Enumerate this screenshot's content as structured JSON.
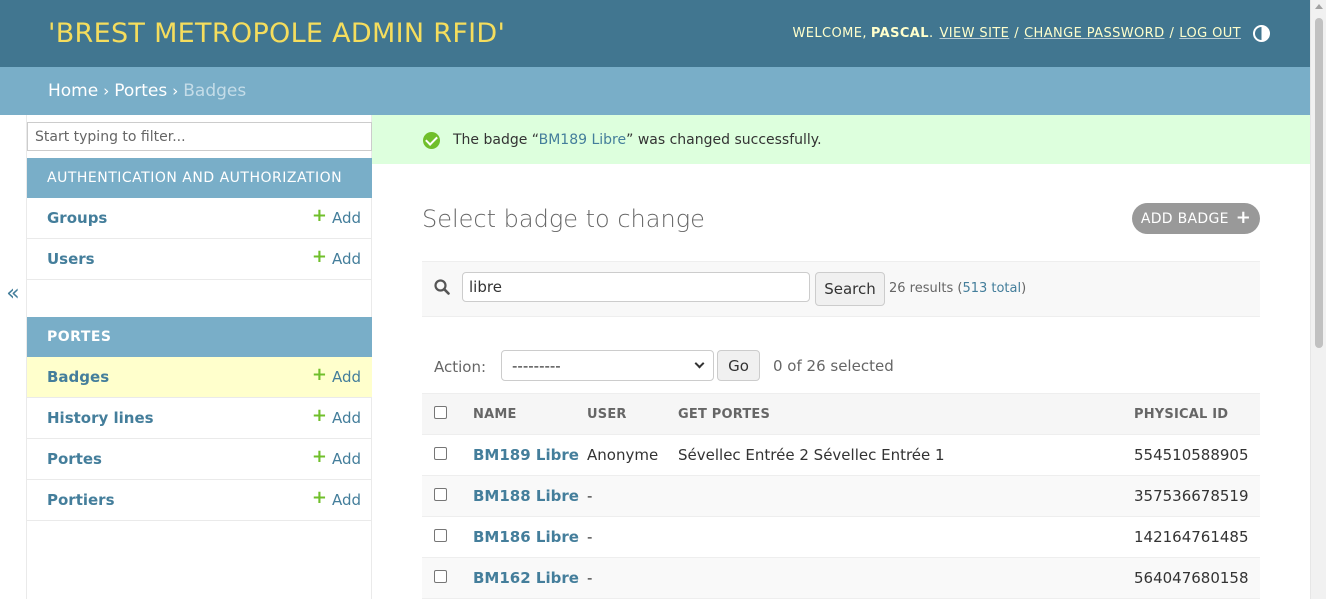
{
  "header": {
    "site_name": "'BREST METROPOLE ADMIN RFID'",
    "welcome": "WELCOME,",
    "username": "PASCAL",
    "view_site": "VIEW SITE",
    "change_password": "CHANGE PASSWORD",
    "log_out": "LOG OUT",
    "sep": "/",
    "theme_icon": "half-circle-icon"
  },
  "breadcrumbs": {
    "home": "Home",
    "app": "Portes",
    "current": "Badges",
    "sep": "›"
  },
  "sidebar": {
    "toggle": "«",
    "filter_placeholder": "Start typing to filter...",
    "apps": [
      {
        "caption": "AUTHENTICATION AND AUTHORIZATION",
        "models": [
          {
            "name": "Groups",
            "add": "Add"
          },
          {
            "name": "Users",
            "add": "Add"
          }
        ]
      },
      {
        "caption": "PORTES",
        "models": [
          {
            "name": "Badges",
            "add": "Add",
            "current": true
          },
          {
            "name": "History lines",
            "add": "Add"
          },
          {
            "name": "Portes",
            "add": "Add"
          },
          {
            "name": "Portiers",
            "add": "Add"
          }
        ]
      }
    ]
  },
  "message": {
    "prefix": "The badge “",
    "link": "BM189 Libre",
    "suffix": "” was changed successfully."
  },
  "content": {
    "title": "Select badge to change",
    "add_button": "ADD BADGE",
    "search": {
      "value": "libre",
      "button": "Search",
      "results": "26 results (",
      "total_link": "513 total",
      "results_close": ")"
    },
    "actions": {
      "label": "Action:",
      "selected_option": "---------",
      "go": "Go",
      "selected_count": "0 of 26 selected"
    },
    "table": {
      "columns": [
        "NAME",
        "USER",
        "GET PORTES",
        "PHYSICAL ID"
      ],
      "rows": [
        {
          "name": "BM189 Libre",
          "user": "Anonyme",
          "portes": "Sévellec Entrée 2 Sévellec Entrée 1",
          "physical_id": "554510588905"
        },
        {
          "name": "BM188 Libre",
          "user": "-",
          "portes": "",
          "physical_id": "357536678519"
        },
        {
          "name": "BM186 Libre",
          "user": "-",
          "portes": "",
          "physical_id": "142164761485"
        },
        {
          "name": "BM162 Libre",
          "user": "-",
          "portes": "",
          "physical_id": "564047680158"
        }
      ]
    }
  }
}
